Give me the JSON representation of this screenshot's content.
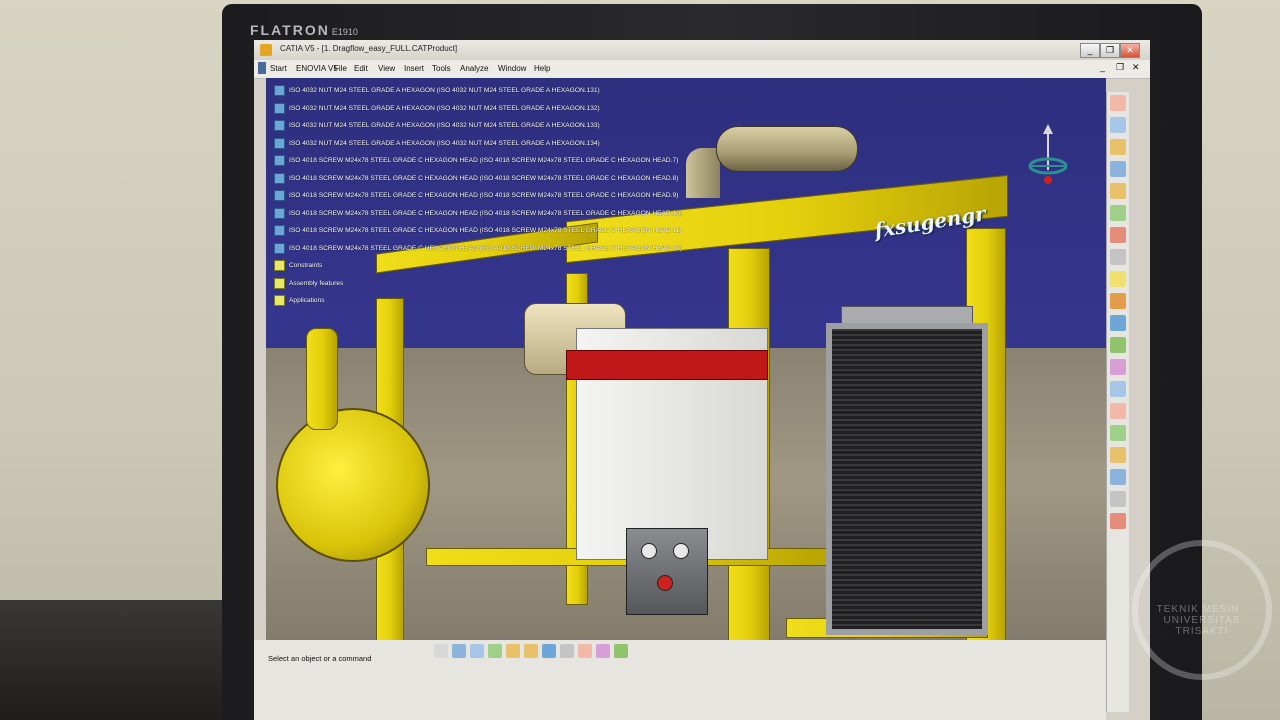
{
  "monitor": {
    "brand": "FLATRON",
    "model": "E1910"
  },
  "window": {
    "title": "CATIA V5 - [1. Dragflow_easy_FULL.CATProduct]",
    "controls": {
      "minimize": "_",
      "restore": "❐",
      "close": "✕"
    }
  },
  "menu": {
    "items": [
      "Start",
      "ENOVIA V5",
      "File",
      "Edit",
      "View",
      "Insert",
      "Tools",
      "Analyze",
      "Window",
      "Help"
    ]
  },
  "tree": {
    "items": [
      "ISO 4032 NUT M24 STEEL GRADE A HEXAGON (ISO 4032 NUT M24 STEEL GRADE A HEXAGON.131)",
      "ISO 4032 NUT M24 STEEL GRADE A HEXAGON (ISO 4032 NUT M24 STEEL GRADE A HEXAGON.132)",
      "ISO 4032 NUT M24 STEEL GRADE A HEXAGON (ISO 4032 NUT M24 STEEL GRADE A HEXAGON.133)",
      "ISO 4032 NUT M24 STEEL GRADE A HEXAGON (ISO 4032 NUT M24 STEEL GRADE A HEXAGON.134)",
      "ISO 4018 SCREW M24x78 STEEL GRADE C HEXAGON HEAD (ISO 4018 SCREW M24x78 STEEL GRADE C HEXAGON HEAD.7)",
      "ISO 4018 SCREW M24x78 STEEL GRADE C HEXAGON HEAD (ISO 4018 SCREW M24x78 STEEL GRADE C HEXAGON HEAD.8)",
      "ISO 4018 SCREW M24x78 STEEL GRADE C HEXAGON HEAD (ISO 4018 SCREW M24x78 STEEL GRADE C HEXAGON HEAD.9)",
      "ISO 4018 SCREW M24x78 STEEL GRADE C HEXAGON HEAD (ISO 4018 SCREW M24x78 STEEL GRADE C HEXAGON HEAD.10)",
      "ISO 4018 SCREW M24x78 STEEL GRADE C HEXAGON HEAD (ISO 4018 SCREW M24x78 STEEL GRADE C HEXAGON HEAD.11)",
      "ISO 4018 SCREW M24x78 STEEL GRADE C HEXAGON HEAD (ISO 4018 SCREW M24x78 STEEL GRADE C HEXAGON HEAD.12)"
    ],
    "special": [
      "Constraints",
      "Assembly features",
      "Applications"
    ]
  },
  "viewport": {
    "watermark": "fxsugengr"
  },
  "status": {
    "prompt": "Select an object or a command"
  },
  "logo": {
    "text": "TEKNIK MESIN · UNIVERSITAS TRISAKTI"
  },
  "colors": {
    "frame_yellow": "#e5d00c",
    "background_blue": "#34358c",
    "engine_red": "#c01818"
  },
  "toolbar_icons": [
    "select-icon",
    "rotate-icon",
    "zoom-icon",
    "pan-icon",
    "fit-all-icon",
    "normal-view-icon",
    "render-icon"
  ]
}
